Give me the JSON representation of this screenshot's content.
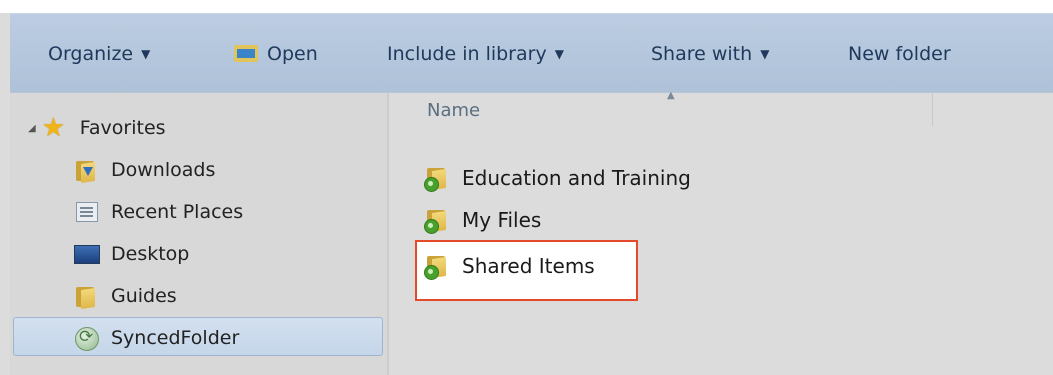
{
  "toolbar": {
    "organize_label": "Organize",
    "open_label": "Open",
    "include_label": "Include in library",
    "share_label": "Share with",
    "new_folder_label": "New folder"
  },
  "nav": {
    "favorites_label": "Favorites",
    "items": [
      {
        "label": "Downloads",
        "icon": "downloads-folder-icon"
      },
      {
        "label": "Recent Places",
        "icon": "recent-places-icon"
      },
      {
        "label": "Desktop",
        "icon": "desktop-icon"
      },
      {
        "label": "Guides",
        "icon": "folder-icon"
      },
      {
        "label": "SyncedFolder",
        "icon": "synced-folder-icon",
        "selected": true
      }
    ]
  },
  "content": {
    "column_header": "Name",
    "files": [
      {
        "label": "Education and Training",
        "icon": "synced-folder-icon"
      },
      {
        "label": "My Files",
        "icon": "synced-folder-icon"
      },
      {
        "label": "Shared Items",
        "icon": "synced-folder-icon",
        "highlighted": true
      }
    ]
  },
  "colors": {
    "toolbar": "#b4c6dc",
    "highlight_border": "#e44a2a",
    "selection": "#c9d9ec"
  }
}
